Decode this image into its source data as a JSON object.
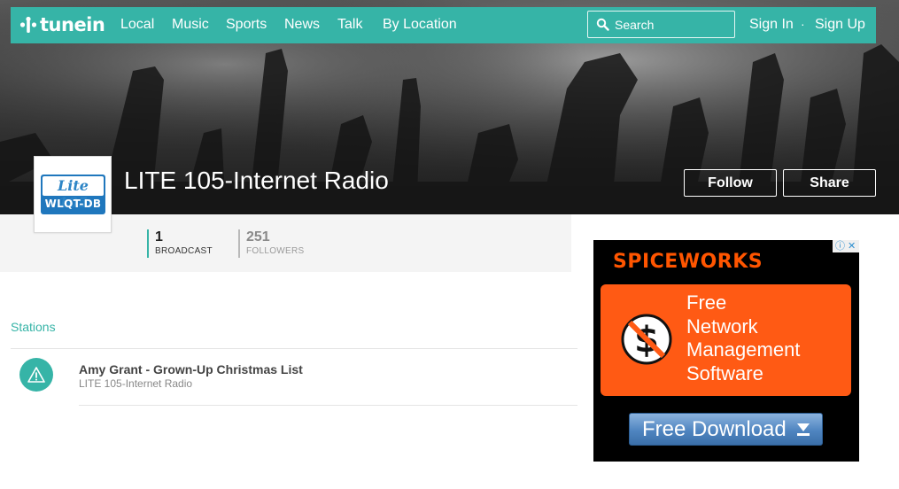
{
  "nav": {
    "logo_text": "tunein",
    "links": [
      {
        "label": "Local"
      },
      {
        "label": "Music"
      },
      {
        "label": "Sports"
      },
      {
        "label": "News"
      },
      {
        "label": "Talk"
      },
      {
        "label": "By Location"
      }
    ],
    "search_placeholder": "Search",
    "sign_in": "Sign In",
    "separator": "·",
    "sign_up": "Sign Up"
  },
  "station": {
    "logo_top": "Lite 105",
    "logo_bottom": "WLQT-DB",
    "title": "LITE 105-Internet Radio",
    "follow_label": "Follow",
    "share_label": "Share"
  },
  "stats": {
    "broadcast_count": "1",
    "broadcast_label": "BROADCAST",
    "followers_count": "251",
    "followers_label": "FOLLOWERS"
  },
  "stations_section": {
    "title": "Stations",
    "items": [
      {
        "title": "Amy Grant - Grown-Up Christmas List",
        "subtitle": "LITE 105-Internet Radio"
      }
    ]
  },
  "ad": {
    "brand": "SPICEWORKS",
    "headline": [
      "Free",
      "Network",
      "Management",
      "Software"
    ],
    "cta_label": "Free Download"
  },
  "colors": {
    "accent": "#36b4a7",
    "ad_orange": "#ff5a14",
    "ad_brand": "#ff5500",
    "ad_button": "#4f85c0"
  },
  "icons": [
    "tunein-logo-icon",
    "search-icon",
    "warning-icon",
    "no-dollar-icon",
    "download-arrow-icon",
    "ad-info-icon",
    "ad-close-icon"
  ]
}
